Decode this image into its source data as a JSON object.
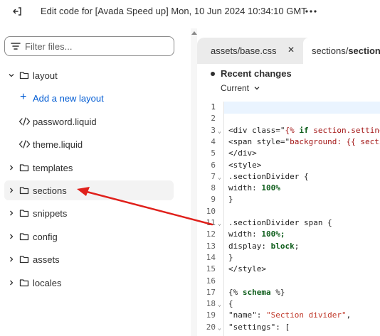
{
  "topbar": {
    "title": "Edit code for [Avada Speed up] Mon, 10 Jun 2024 10:34:10 GMT"
  },
  "sidebar": {
    "filter_placeholder": "Filter files...",
    "items": [
      {
        "label": "layout",
        "type": "folder",
        "expanded": true
      },
      {
        "label": "Add a new layout",
        "type": "action"
      },
      {
        "label": "password.liquid",
        "type": "file"
      },
      {
        "label": "theme.liquid",
        "type": "file"
      },
      {
        "label": "templates",
        "type": "folder",
        "expanded": false
      },
      {
        "label": "sections",
        "type": "folder",
        "expanded": false
      },
      {
        "label": "snippets",
        "type": "folder",
        "expanded": false
      },
      {
        "label": "config",
        "type": "folder",
        "expanded": false
      },
      {
        "label": "assets",
        "type": "folder",
        "expanded": false
      },
      {
        "label": "locales",
        "type": "folder",
        "expanded": false
      }
    ]
  },
  "editor": {
    "tabs": [
      {
        "label": "assets/base.css",
        "active": false,
        "close": "✕"
      },
      {
        "label_prefix": "sections/",
        "label_bold": "section-",
        "active": true
      }
    ],
    "changes_title": "Recent changes",
    "changes_select": "Current",
    "lines": [
      {
        "n": "1",
        "fold": false
      },
      {
        "n": "2",
        "fold": false
      },
      {
        "n": "3",
        "fold": true
      },
      {
        "n": "4",
        "fold": false
      },
      {
        "n": "5",
        "fold": false
      },
      {
        "n": "6",
        "fold": false
      },
      {
        "n": "7",
        "fold": true
      },
      {
        "n": "8",
        "fold": false
      },
      {
        "n": "9",
        "fold": false
      },
      {
        "n": "10",
        "fold": false
      },
      {
        "n": "11",
        "fold": true
      },
      {
        "n": "12",
        "fold": false
      },
      {
        "n": "13",
        "fold": false
      },
      {
        "n": "14",
        "fold": false
      },
      {
        "n": "15",
        "fold": false
      },
      {
        "n": "16",
        "fold": false
      },
      {
        "n": "17",
        "fold": false
      },
      {
        "n": "18",
        "fold": true
      },
      {
        "n": "19",
        "fold": false
      },
      {
        "n": "20",
        "fold": true
      }
    ],
    "code": {
      "l3a": "<div class=\"",
      "l3b": "{% ",
      "l3c": "if",
      "l3d": " section.setting",
      "l4a": "<span style=\"",
      "l4b": "background: {{ sectio",
      "l5": "</div>",
      "l6": "<style>",
      "l7": ".sectionDivider {",
      "l8a": "width: ",
      "l8b": "100%",
      "l9": "}",
      "l11": ".sectionDivider span {",
      "l12a": "width: ",
      "l12b": "100%;",
      "l13a": "display: ",
      "l13b": "block",
      "l13c": ";",
      "l14": "}",
      "l15": "</style>",
      "l17a": "{% ",
      "l17b": "schema",
      "l17c": " %}",
      "l18": "{",
      "l19a": "\"name\": ",
      "l19b": "\"Section divider\"",
      "l19c": ",",
      "l20a": "\"settings\": ["
    }
  },
  "colors": {
    "accent": "#005bd3",
    "annotation": "#e0201b",
    "active_line": "#eaf4ff"
  }
}
